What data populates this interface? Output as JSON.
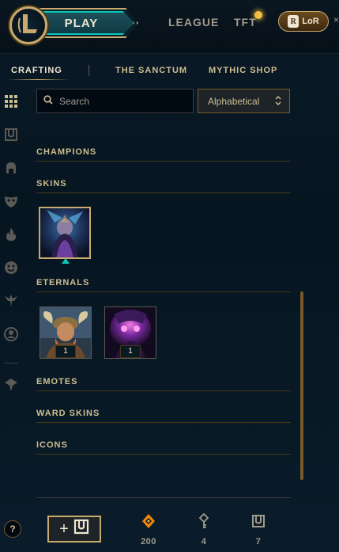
{
  "topnav": {
    "play_label": "PLAY",
    "league_label": "LEAGUE",
    "tft_label": "TFT",
    "lor_label": "LoR",
    "lor_emblem": "R",
    "close_glyph": "×"
  },
  "subnav": {
    "tabs": [
      "CRAFTING",
      "THE SANCTUM",
      "MYTHIC SHOP"
    ],
    "active_tab": "CRAFTING"
  },
  "sidebar": {
    "icons": [
      "grid-icon",
      "chest-icon",
      "champion-helmet-icon",
      "skin-mask-icon",
      "fire-icon",
      "emote-face-icon",
      "ward-icon",
      "profile-icon",
      "dropdown-filter-icon"
    ]
  },
  "search": {
    "placeholder": "Search",
    "value": ""
  },
  "sort": {
    "selected": "Alphabetical"
  },
  "sections": {
    "champions": "CHAMPIONS",
    "skins": "SKINS",
    "eternals": "ETERNALS",
    "emotes": "EMOTES",
    "ward_skins": "WARD SKINS",
    "icons": "ICONS"
  },
  "eternals_items": [
    {
      "count": "1"
    },
    {
      "count": "1"
    }
  ],
  "bottom": {
    "help_label": "?",
    "add_label": "+",
    "currencies": [
      {
        "icon": "orange-essence-icon",
        "value": "200"
      },
      {
        "icon": "key-icon",
        "value": "4"
      },
      {
        "icon": "chest-icon",
        "value": "7"
      }
    ]
  },
  "colors": {
    "gold": "#c8aa6e",
    "teal": "#0ac8b9",
    "orange_essence": "#f0870a",
    "background": "#010a13"
  }
}
